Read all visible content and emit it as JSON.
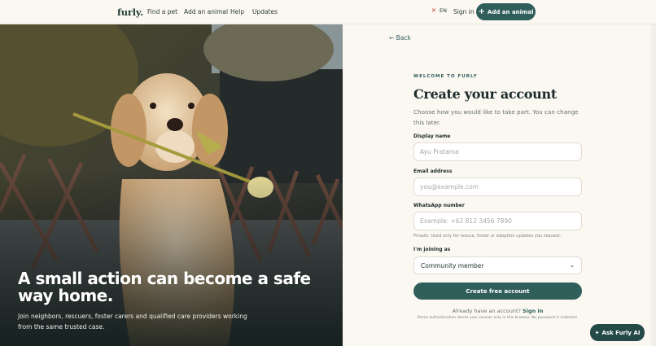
{
  "header": {
    "logo": "furly.",
    "nav": [
      "Find a pet",
      "Add an animal",
      "Help",
      "Updates"
    ],
    "lang": "EN",
    "signin": "Sign in",
    "add_button": "Add an animal",
    "add_icon": "plus-icon"
  },
  "hero": {
    "title": "A small action can become a safe way home.",
    "subtitle": "Join neighbors, rescuers, foster carers and qualified care providers working from the same trusted case."
  },
  "form": {
    "back": "← Back",
    "eyebrow": "WELCOME TO FURLY",
    "title": "Create your account",
    "description": "Choose how you would like to take part. You can change this later.",
    "display_name_label": "Display name",
    "display_name_placeholder": "Ayu Pratama",
    "email_label": "Email address",
    "email_placeholder": "you@example.com",
    "whatsapp_label": "WhatsApp number",
    "whatsapp_placeholder": "Example: +62 812 3456 7890",
    "whatsapp_hint": "Private. Used only for rescue, foster or adoption updates you request.",
    "joining_label": "I'm joining as",
    "joining_value": "Community member",
    "submit": "Create free account",
    "already_text": "Already have an account?",
    "already_link": "Sign in",
    "demo_note": "Demo authentication stores your session only in this browser. No password is collected."
  },
  "assistant": {
    "label": "Ask Furly AI",
    "icon": "sparkle-icon"
  },
  "colors": {
    "brand": "#2f5e5b",
    "background": "#fbf8f1"
  }
}
